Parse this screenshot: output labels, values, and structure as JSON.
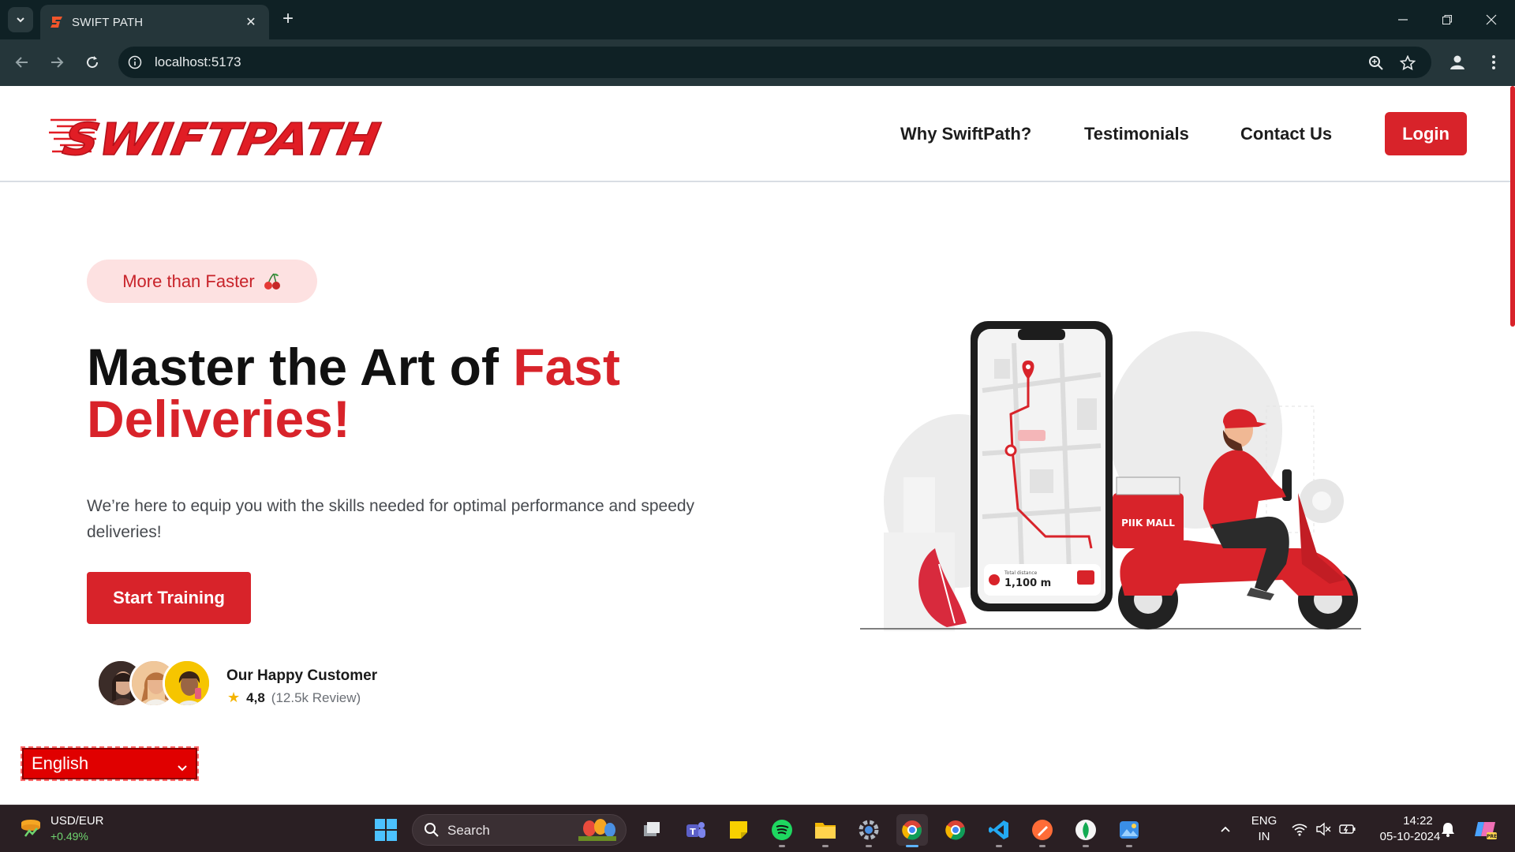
{
  "browser": {
    "tab_title": "SWIFT PATH",
    "url": "localhost:5173",
    "icons": [
      "tab-search-icon",
      "close-icon",
      "new-tab-icon",
      "minimize-icon",
      "restore-icon",
      "window-close-icon",
      "back-icon",
      "forward-icon",
      "reload-icon",
      "site-info-icon",
      "zoom-icon",
      "bookmark-star-icon",
      "profile-icon",
      "kebab-menu-icon"
    ]
  },
  "header": {
    "logo_text": "SWIFTPATH",
    "nav": [
      {
        "label": "Why SwiftPath?"
      },
      {
        "label": "Testimonials"
      },
      {
        "label": "Contact Us"
      }
    ],
    "login_label": "Login"
  },
  "hero": {
    "pill_label": "More than Faster",
    "title_part1": "Master the Art of ",
    "title_accent": "Fast Deliveries!",
    "subtitle": "We’re here to equip you with the skills needed for optimal performance and speedy deliveries!",
    "cta_label": "Start Training",
    "customers_title": "Our Happy Customer",
    "rating_score": "4,8",
    "rating_reviews": "(12.5k Review)"
  },
  "illustration": {
    "distance_label": "Total distance",
    "distance_value": "1,100 m",
    "box_brand": "PIIK MALL"
  },
  "language_select": {
    "selected": "English"
  },
  "taskbar": {
    "ticker_label": "USD/EUR",
    "ticker_change": "+0.49%",
    "search_label": "Search",
    "language_top": "ENG",
    "language_bottom": "IN",
    "time": "14:22",
    "date": "05-10-2024"
  },
  "colors": {
    "brand_red": "#d8232a",
    "chrome_dark": "#0f2125",
    "taskbar_bg": "#2a1f23"
  }
}
